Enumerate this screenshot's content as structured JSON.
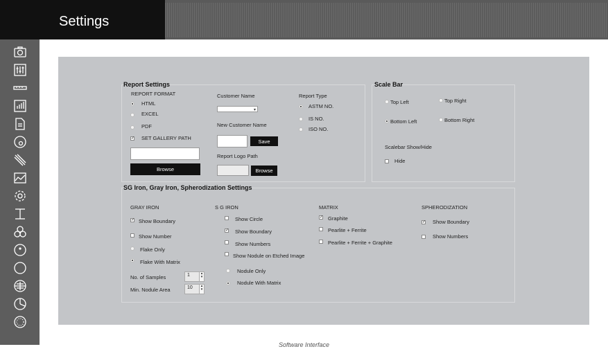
{
  "app": {
    "title": "Settings",
    "caption": "Software Interface"
  },
  "sidebar_icons": [
    "camera-icon",
    "sliders-icon",
    "ruler-icon",
    "bar-chart-icon",
    "document-icon",
    "disc-icon",
    "lines-icon",
    "area-chart-icon",
    "gear-icon",
    "beam-icon",
    "circles-icon",
    "circle-dot-icon",
    "circle-icon",
    "crosshair-icon",
    "pie-icon",
    "dotted-circle-icon"
  ],
  "report": {
    "title": "Report Settings",
    "format_label": "REPORT FORMAT",
    "formats": [
      {
        "label": "HTML",
        "selected": true
      },
      {
        "label": "EXCEL",
        "selected": false
      },
      {
        "label": "PDF",
        "selected": false
      }
    ],
    "gallery_label": "SET GALLERY PATH",
    "gallery_checked": true,
    "gallery_path": "",
    "browse_label": "Browse",
    "customer_name_label": "Customer Name",
    "customer_value": "",
    "new_customer_label": "New Customer Name",
    "new_customer_value": "",
    "save_label": "Save",
    "logo_path_label": "Report Logo Path",
    "logo_path_value": "",
    "logo_browse_label": "Browse",
    "type_label": "Report Type",
    "types": [
      {
        "label": "ASTM NO.",
        "selected": true
      },
      {
        "label": "IS NO.",
        "selected": false
      },
      {
        "label": "ISO NO.",
        "selected": false
      }
    ]
  },
  "scalebar": {
    "title": "Scale Bar",
    "positions": [
      {
        "label": "Top Left",
        "selected": false
      },
      {
        "label": "Top Right",
        "selected": false
      },
      {
        "label": "Bottom Left",
        "selected": true
      },
      {
        "label": "Bottom Right",
        "selected": false
      }
    ],
    "show_hide_label": "Scalebar Show/Hide",
    "hide_label": "Hide",
    "hide_checked": false
  },
  "sg": {
    "title": "SG Iron, Gray Iron, Spherodization Settings",
    "gray": {
      "title": "GRAY IRON",
      "show_boundary": {
        "label": "Show Boundary",
        "checked": true
      },
      "show_number": {
        "label": "Show Number",
        "checked": false
      },
      "flake_only": {
        "label": "Flake Only",
        "selected": false
      },
      "flake_matrix": {
        "label": "Flake With Matrix",
        "selected": true
      },
      "samples_label": "No. of Samples",
      "samples_value": "1",
      "min_area_label": "Min. Nodule Area",
      "min_area_value": "10"
    },
    "sgiron": {
      "title": "S G IRON",
      "show_circle": {
        "label": "Show Circle",
        "checked": false
      },
      "show_boundary": {
        "label": "Show Boundary",
        "checked": true
      },
      "show_numbers": {
        "label": "Show Numbers",
        "checked": false
      },
      "show_etched": {
        "label": "Show Nodule on Etched Image",
        "checked": false
      },
      "nodule_only": {
        "label": "Nodule Only",
        "selected": false
      },
      "nodule_matrix": {
        "label": "Nodule With Matrix",
        "selected": true
      }
    },
    "matrix": {
      "title": "MATRIX",
      "graphite": {
        "label": "Graphite",
        "checked": true
      },
      "pearlite_ferrite": {
        "label": "Pearlite + Ferrite",
        "checked": false
      },
      "pearlite_ferrite_graphite": {
        "label": "Pearlite + Ferrite + Graphite",
        "checked": false
      }
    },
    "spher": {
      "title": "SPHERODIZATION",
      "show_boundary": {
        "label": "Show Boundary",
        "checked": true
      },
      "show_numbers": {
        "label": "Show Numbers",
        "checked": false
      }
    }
  }
}
